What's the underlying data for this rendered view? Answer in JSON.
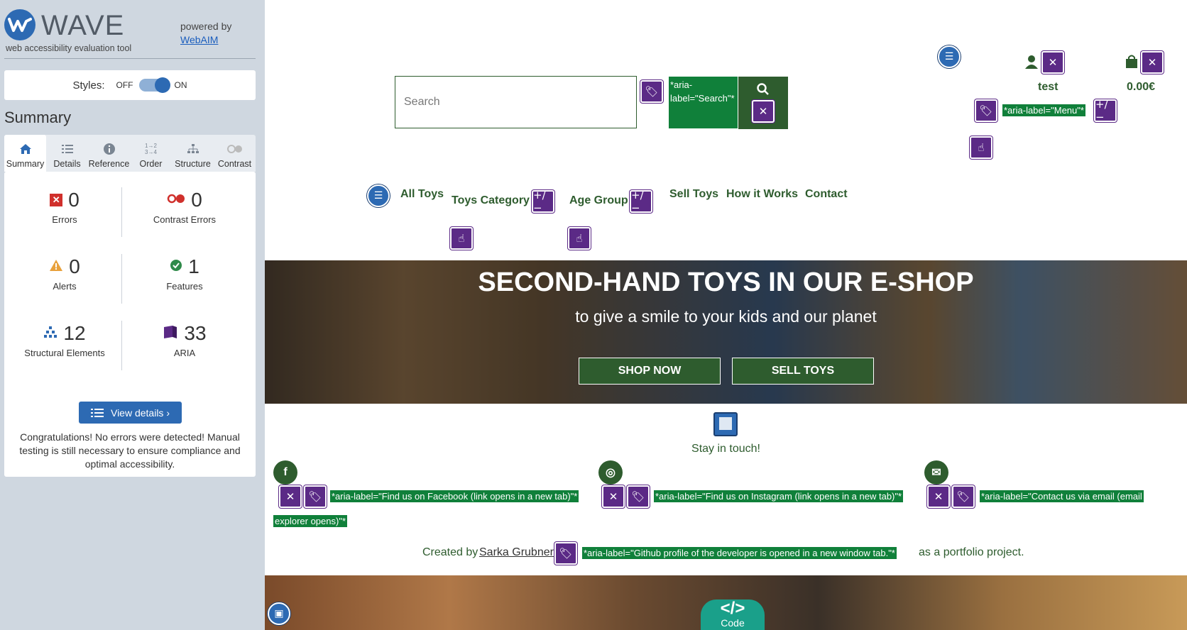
{
  "wave": {
    "logo_text": "WAVE",
    "logo_sub": "web accessibility evaluation tool",
    "powered_by": "powered by",
    "webaim_link": "WebAIM",
    "styles_label": "Styles:",
    "styles_off": "OFF",
    "styles_on": "ON",
    "summary_title": "Summary",
    "tabs": [
      {
        "label": "Summary",
        "icon": "home-icon"
      },
      {
        "label": "Details",
        "icon": "list-icon"
      },
      {
        "label": "Reference",
        "icon": "info-icon"
      },
      {
        "label": "Order",
        "icon": "order-icon"
      },
      {
        "label": "Structure",
        "icon": "structure-icon"
      },
      {
        "label": "Contrast",
        "icon": "contrast-icon"
      }
    ],
    "stats": {
      "errors": {
        "value": "0",
        "label": "Errors"
      },
      "contrast": {
        "value": "0",
        "label": "Contrast Errors"
      },
      "alerts": {
        "value": "0",
        "label": "Alerts"
      },
      "features": {
        "value": "1",
        "label": "Features"
      },
      "structural": {
        "value": "12",
        "label": "Structural Elements"
      },
      "aria": {
        "value": "33",
        "label": "ARIA"
      }
    },
    "view_details": "View details ›",
    "congrats": "Congratulations! No errors were detected! Manual testing is still necessary to ensure compliance and optimal accessibility."
  },
  "site": {
    "search_placeholder": "Search",
    "search_aria": "*aria-label=\"Search\"*",
    "user_name": "test",
    "cart_total": "0.00€",
    "menu_aria": "*aria-label=\"Menu\"*",
    "nav": [
      "All Toys",
      "Toys Category",
      "Age Group",
      "Sell Toys",
      "How it Works",
      "Contact"
    ],
    "hero_title": "SECOND-HAND TOYS IN OUR E-SHOP",
    "hero_sub": "to give a smile to your kids and our planet",
    "shop_now": "SHOP NOW",
    "sell_toys": "SELL TOYS",
    "stay_in_touch": "Stay in touch!",
    "aria_facebook": "*aria-label=\"Find us on Facebook (link opens in a new tab)\"*",
    "aria_instagram": "*aria-label=\"Find us on Instagram (link opens in a new tab)\"*",
    "aria_email": "*aria-label=\"Contact us via email (email",
    "aria_email_cont": "explorer opens)\"*",
    "created_by": "Created by",
    "author": "Sarka Grubner",
    "aria_github": "*aria-label=\"Github profile of the developer is opened in a new window tab.\"*",
    "portfolio": "as a portfolio project.",
    "code_label": "Code",
    "code_symbol": "</>"
  }
}
